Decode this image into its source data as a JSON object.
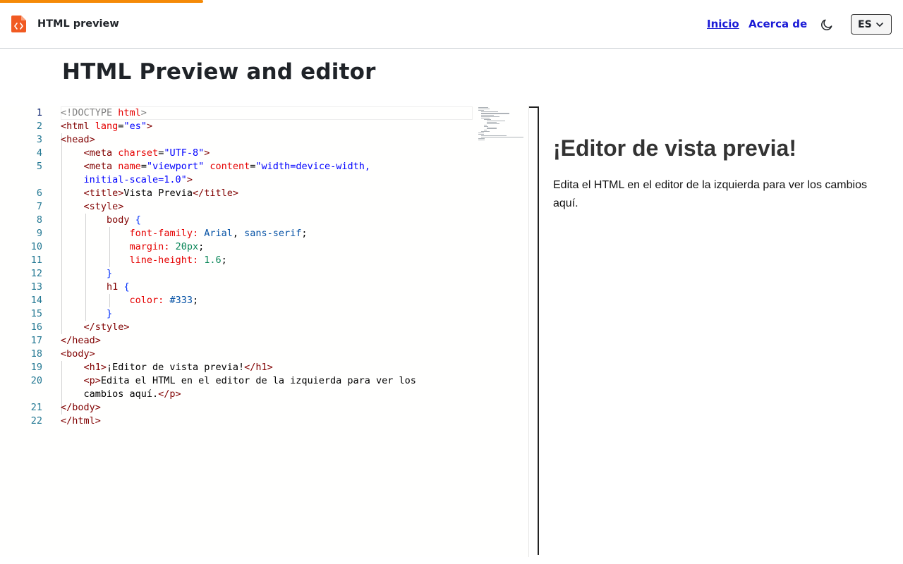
{
  "app": {
    "brand_name": "HTML preview",
    "page_title": "HTML Preview and editor"
  },
  "colors": {
    "accent": "#f58a07",
    "nav_link": "#1a1ad6",
    "logo": "#f15a22"
  },
  "nav": {
    "home_label": "Inicio",
    "about_label": "Acerca de",
    "theme_icon": "moon-icon",
    "language_value": "ES"
  },
  "editor": {
    "line_numbers": [
      "1",
      "2",
      "3",
      "4",
      "5",
      "",
      "6",
      "7",
      "8",
      "9",
      "10",
      "11",
      "12",
      "13",
      "14",
      "15",
      "16",
      "17",
      "18",
      "19",
      "20",
      "",
      "21",
      "22"
    ],
    "active_line": "1"
  },
  "preview": {
    "heading": "¡Editor de vista previa!",
    "paragraph": "Edita el HTML en el editor de la izquierda para ver los cambios aquí."
  }
}
